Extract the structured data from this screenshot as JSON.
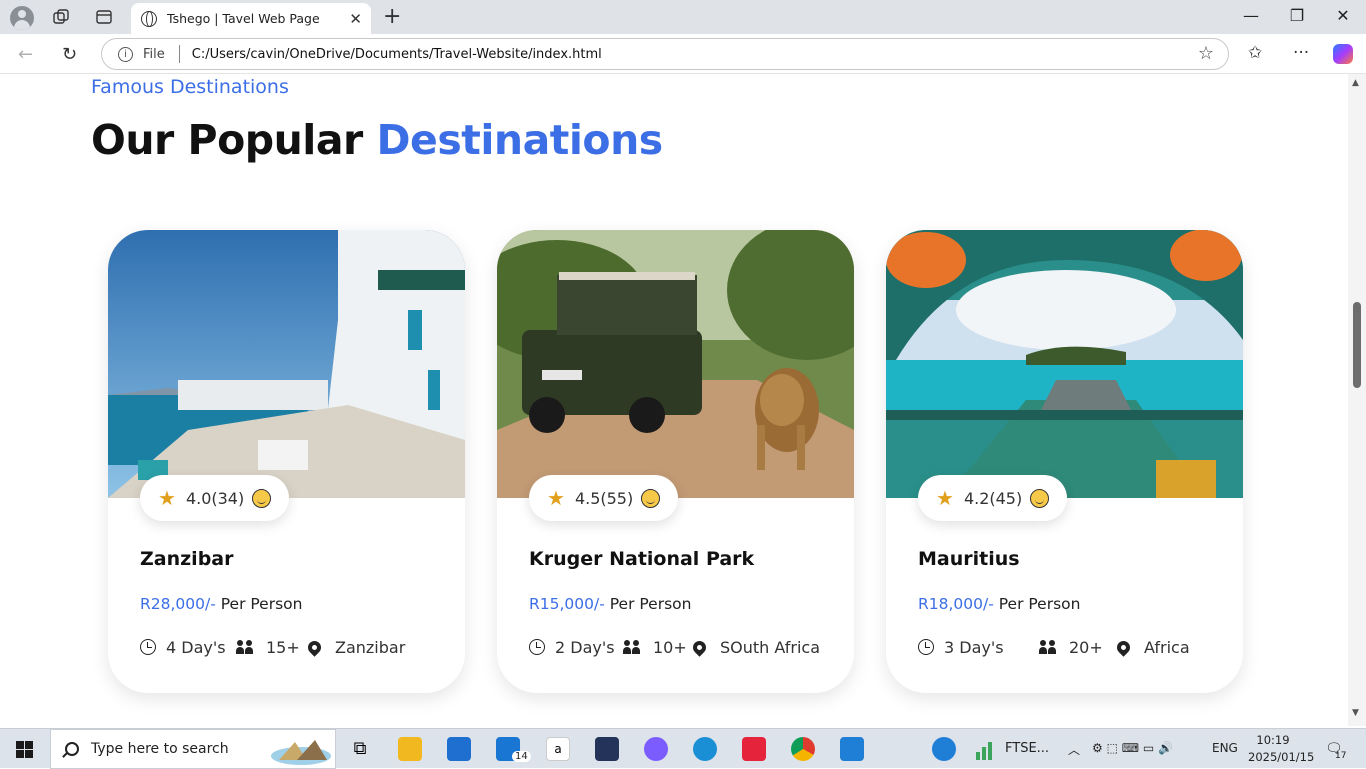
{
  "browser": {
    "tab_title": "Tshego | Tavel Web Page",
    "file_label": "File",
    "url": "C:/Users/cavin/OneDrive/Documents/Travel-Website/index.html"
  },
  "section": {
    "eyebrow": "Famous Destinations",
    "heading_main": "Our Popular ",
    "heading_accent": "Destinations"
  },
  "cards": [
    {
      "rating": "4.0(34)",
      "name": "Zanzibar",
      "price": "R28,000/-",
      "per": " Per Person",
      "days": "4 Day's",
      "people": "15+",
      "location": "Zanzibar"
    },
    {
      "rating": "4.5(55)",
      "name": "Kruger National Park",
      "price": "R15,000/-",
      "per": " Per Person",
      "days": "2 Day's",
      "people": "10+",
      "location": "SOuth Africa"
    },
    {
      "rating": "4.2(45)",
      "name": "Mauritius",
      "price": "R18,000/-",
      "per": " Per Person",
      "days": "3 Day's",
      "people": "20+",
      "location": "Africa"
    }
  ],
  "taskbar": {
    "search_placeholder": "Type here to search",
    "mail_badge": "14",
    "ftse_label": "FTSE...",
    "language": "ENG",
    "time": "10:19",
    "date": "2025/01/15",
    "notification_count": "17"
  },
  "colors": {
    "accent": "#3c6ee6",
    "star": "#e0a01c"
  }
}
